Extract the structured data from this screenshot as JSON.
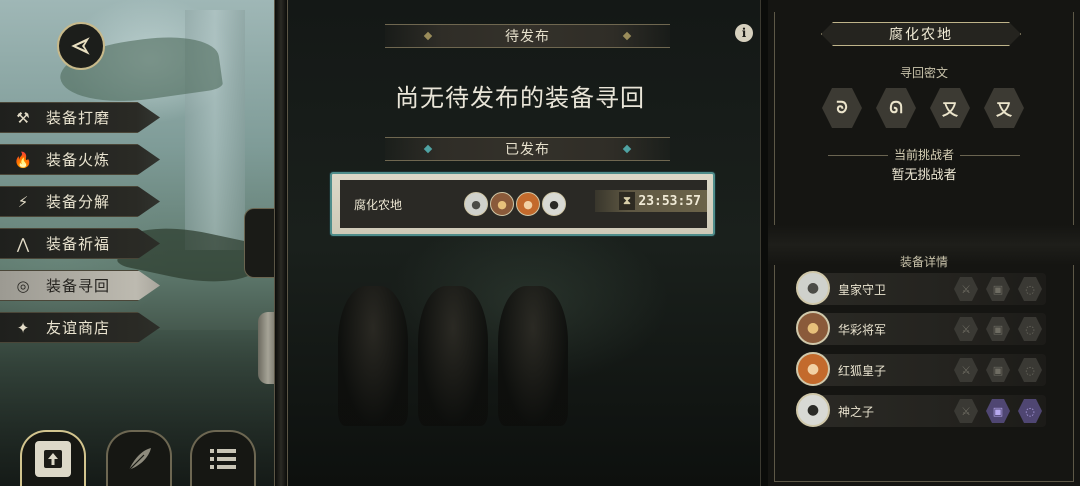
{
  "menu": {
    "items": [
      {
        "label": "装备打磨",
        "icon": "hammer-icon",
        "glyph": "⚒",
        "active": false
      },
      {
        "label": "装备火炼",
        "icon": "flame-icon",
        "glyph": "🔥",
        "active": false
      },
      {
        "label": "装备分解",
        "icon": "split-icon",
        "glyph": "⚡",
        "active": false
      },
      {
        "label": "装备祈福",
        "icon": "pray-icon",
        "glyph": "⋀",
        "active": false
      },
      {
        "label": "装备寻回",
        "icon": "target-icon",
        "glyph": "◎",
        "active": true
      },
      {
        "label": "友谊商店",
        "icon": "fox-icon",
        "glyph": "✦",
        "active": false
      }
    ]
  },
  "center": {
    "pending_header": "待发布",
    "pending_empty": "尚无待发布的装备寻回",
    "published_header": "已发布",
    "published": [
      {
        "name": "腐化农地",
        "timer": "23:53:57"
      }
    ],
    "info_glyph": "i"
  },
  "right": {
    "region": "腐化农地",
    "cipher_label": "寻回密文",
    "cipher_glyphs": [
      "ᘐ",
      "ᘏ",
      "又",
      "又"
    ],
    "challenger_label": "当前挑战者",
    "challenger_value": "暂无挑战者",
    "equip_label": "装备详情",
    "equip": [
      {
        "name": "皇家守卫",
        "slots": [
          false,
          false,
          false
        ]
      },
      {
        "name": "华彩将军",
        "slots": [
          false,
          false,
          false
        ]
      },
      {
        "name": "红狐皇子",
        "slots": [
          false,
          false,
          false
        ]
      },
      {
        "name": "神之子",
        "slots": [
          false,
          true,
          true
        ]
      }
    ]
  },
  "colors": {
    "accent_teal": "#4f8d8b",
    "gold_border": "#c7b98a",
    "purple_slot": "#4f4672"
  }
}
